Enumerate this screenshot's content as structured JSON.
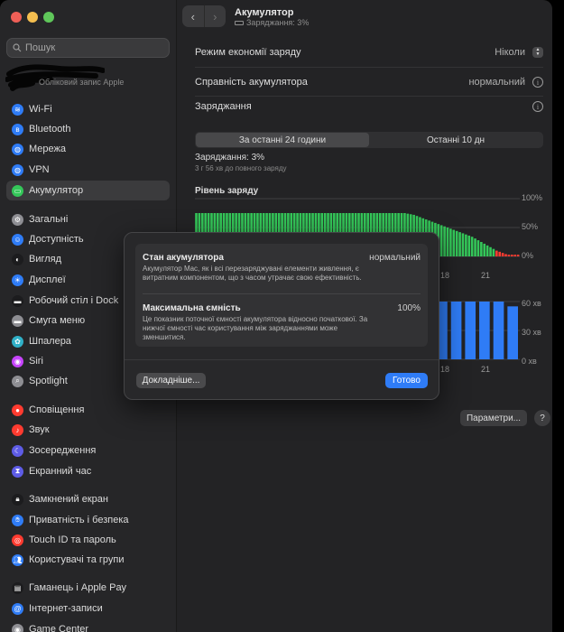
{
  "window": {
    "title": "Акумулятор",
    "subtitle": "Заряджання: 3%"
  },
  "sidebar": {
    "search_placeholder": "Пошук",
    "account_label": "Обліковий запис Apple",
    "items": [
      {
        "label": "Wi-Fi",
        "icon": "wifi-icon",
        "color": "#2f7cf6",
        "glyph": "≋"
      },
      {
        "label": "Bluetooth",
        "icon": "bluetooth-icon",
        "color": "#2f7cf6",
        "glyph": "ʙ"
      },
      {
        "label": "Мережа",
        "icon": "network-icon",
        "color": "#2f7cf6",
        "glyph": "◍"
      },
      {
        "label": "VPN",
        "icon": "vpn-icon",
        "color": "#2f7cf6",
        "glyph": "◍"
      },
      {
        "label": "Акумулятор",
        "icon": "battery-icon",
        "color": "#34c759",
        "glyph": "▭"
      },
      {
        "label": "Загальні",
        "icon": "gear-icon",
        "color": "#8e8e93",
        "glyph": "⚙"
      },
      {
        "label": "Доступність",
        "icon": "accessibility-icon",
        "color": "#2f7cf6",
        "glyph": "☺"
      },
      {
        "label": "Вигляд",
        "icon": "appearance-icon",
        "color": "#1c1c1e",
        "glyph": "◐"
      },
      {
        "label": "Дисплеї",
        "icon": "display-icon",
        "color": "#2f7cf6",
        "glyph": "☀"
      },
      {
        "label": "Робочий стіл і Dock",
        "icon": "dock-icon",
        "color": "#1c1c1e",
        "glyph": "▬"
      },
      {
        "label": "Смуга меню",
        "icon": "menubar-icon",
        "color": "#8e8e93",
        "glyph": "▬"
      },
      {
        "label": "Шпалера",
        "icon": "wallpaper-icon",
        "color": "#30b0c7",
        "glyph": "✿"
      },
      {
        "label": "Siri",
        "icon": "siri-icon",
        "color": "#c644fc",
        "glyph": "◉"
      },
      {
        "label": "Spotlight",
        "icon": "spotlight-icon",
        "color": "#8e8e93",
        "glyph": "⌕"
      },
      {
        "label": "Сповіщення",
        "icon": "notifications-icon",
        "color": "#ff3b30",
        "glyph": "●"
      },
      {
        "label": "Звук",
        "icon": "sound-icon",
        "color": "#ff3b30",
        "glyph": "♪"
      },
      {
        "label": "Зосередження",
        "icon": "focus-icon",
        "color": "#5e5ce6",
        "glyph": "☾"
      },
      {
        "label": "Екранний час",
        "icon": "screentime-icon",
        "color": "#5e5ce6",
        "glyph": "⧗"
      },
      {
        "label": "Замкнений екран",
        "icon": "lockscreen-icon",
        "color": "#1c1c1e",
        "glyph": "🔒︎"
      },
      {
        "label": "Приватність і безпека",
        "icon": "privacy-icon",
        "color": "#2f7cf6",
        "glyph": "✋︎"
      },
      {
        "label": "Touch ID та пароль",
        "icon": "touchid-icon",
        "color": "#ff3b30",
        "glyph": "◎"
      },
      {
        "label": "Користувачі та групи",
        "icon": "users-icon",
        "color": "#2f7cf6",
        "glyph": "👥︎"
      },
      {
        "label": "Гаманець і Apple Pay",
        "icon": "wallet-icon",
        "color": "#1c1c1e",
        "glyph": "▤"
      },
      {
        "label": "Інтернет-записи",
        "icon": "internet-accounts-icon",
        "color": "#2f7cf6",
        "glyph": "@"
      },
      {
        "label": "Game Center",
        "icon": "gamecenter-icon",
        "color": "#8e8e93",
        "glyph": "◉"
      }
    ]
  },
  "settings": {
    "low_power_label": "Режим економії заряду",
    "low_power_value": "Ніколи",
    "health_label": "Справність акумулятора",
    "health_value": "нормальний",
    "charging_label": "Заряджання"
  },
  "tabs": [
    "За останні 24 години",
    "Останні 10 дн"
  ],
  "status": {
    "charge": "Заряджання: 3%",
    "time_to_full": "3 г 56 хв до повного заряду"
  },
  "chart_labels": {
    "level_title": "Рівень заряду",
    "level_axis": [
      "100%",
      "50%",
      "0%"
    ],
    "usage_axis": [
      "60 хв",
      "30 хв",
      "0 хв"
    ],
    "x_ticks": [
      "18",
      "21"
    ]
  },
  "chart_data": [
    {
      "type": "bar",
      "title": "Рівень заряду",
      "ylim": [
        0,
        100
      ],
      "series": [
        {
          "values": [
            75,
            75,
            75,
            75,
            75,
            75,
            75,
            75,
            75,
            75,
            75,
            75,
            75,
            75,
            75,
            75,
            75,
            75,
            75,
            75,
            75,
            75,
            75,
            75,
            75,
            75,
            75,
            75,
            75,
            75,
            75,
            75,
            75,
            75,
            75,
            75,
            75,
            75,
            75,
            75,
            75,
            75,
            75,
            75,
            75,
            75,
            75,
            75,
            75,
            75,
            75,
            75,
            75,
            75,
            75,
            75,
            75,
            75,
            75,
            75,
            75,
            75,
            75,
            75,
            75,
            75,
            75,
            75,
            75,
            74,
            73,
            72,
            70,
            68,
            66,
            64,
            62,
            60,
            58,
            56,
            54,
            52,
            50,
            48,
            46,
            44,
            42,
            40,
            38,
            36,
            34,
            31,
            28,
            25,
            22,
            19,
            16,
            13,
            10,
            8,
            6,
            4,
            3,
            3,
            3,
            3
          ]
        }
      ],
      "x_ticks": [
        "18",
        "21"
      ]
    },
    {
      "type": "bar",
      "ylim": [
        0,
        60
      ],
      "categories": [
        "",
        "",
        "",
        "",
        "",
        "",
        "",
        "",
        "",
        "",
        "",
        "",
        "",
        "",
        "",
        "",
        "",
        "",
        "",
        "",
        "",
        "",
        ""
      ],
      "series": [
        {
          "values": [
            0,
            0,
            0,
            0,
            0,
            0,
            0,
            0,
            0,
            0,
            0,
            0,
            0,
            0,
            0,
            0,
            0,
            60,
            60,
            60,
            60,
            60,
            55
          ]
        }
      ],
      "x_ticks": [
        "18",
        "21"
      ]
    }
  ],
  "colors": {
    "accent": "#2f7cf6",
    "charge_bar": "#34c759",
    "low_bar": "#ff3b30",
    "usage_bar": "#2f7cf6"
  },
  "modal": {
    "condition_title": "Стан акумулятора",
    "condition_value": "нормальний",
    "condition_desc": "Акумулятор Mac, як і всі перезаряджувані елементи живлення, є витратним компонентом, що з часом утрачає свою ефективність.",
    "capacity_title": "Максимальна ємність",
    "capacity_value": "100%",
    "capacity_desc": "Це показник поточної ємності акумулятора відносно початкової. За нижчої ємності час користування між заряджаннями може зменшитися.",
    "more_button": "Докладніше...",
    "done_button": "Готово"
  },
  "footer": {
    "params_button": "Параметри...",
    "help_button": "?"
  }
}
